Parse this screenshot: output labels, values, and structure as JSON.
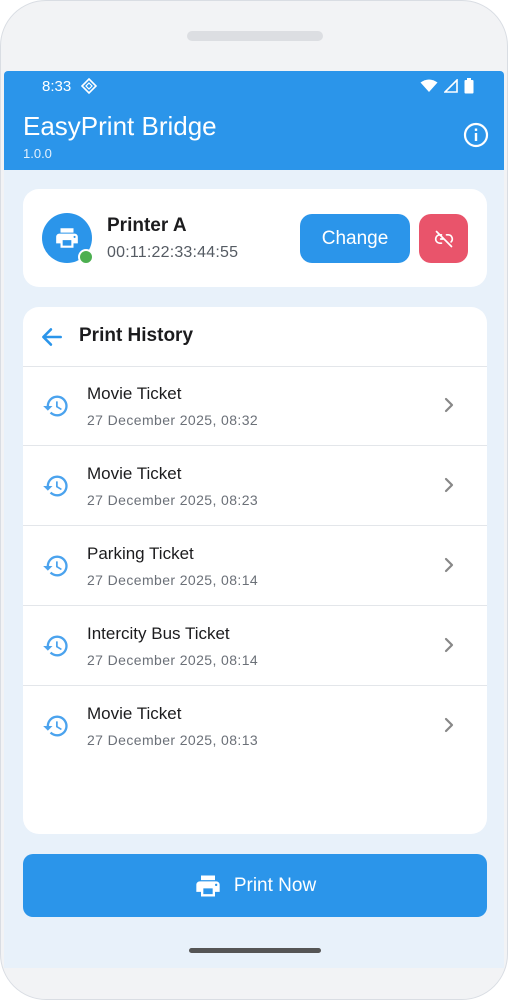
{
  "status_bar": {
    "time": "8:33",
    "icons": [
      "location-diamond-icon",
      "wifi-icon",
      "signal-icon",
      "battery-icon"
    ]
  },
  "app_bar": {
    "title": "EasyPrint Bridge",
    "version": "1.0.0",
    "action_icon": "info-icon"
  },
  "printer": {
    "name": "Printer A",
    "mac": "00:11:22:33:44:55",
    "status": "connected",
    "change_label": "Change",
    "disconnect_icon": "link-off-icon"
  },
  "history": {
    "title": "Print History",
    "back_icon": "arrow-left-icon",
    "items": [
      {
        "title": "Movie Ticket",
        "date": "27 December 2025, 08:32"
      },
      {
        "title": "Movie Ticket",
        "date": "27 December 2025, 08:23"
      },
      {
        "title": "Parking Ticket",
        "date": "27 December 2025, 08:14"
      },
      {
        "title": "Intercity Bus Ticket",
        "date": "27 December 2025, 08:14"
      },
      {
        "title": "Movie Ticket",
        "date": "27 December 2025, 08:13"
      }
    ]
  },
  "print_button": {
    "label": "Print Now",
    "icon": "printer-icon"
  },
  "colors": {
    "primary": "#2b95ea",
    "danger": "#e9546b",
    "online": "#4caf50",
    "background": "#e8f1fa"
  }
}
